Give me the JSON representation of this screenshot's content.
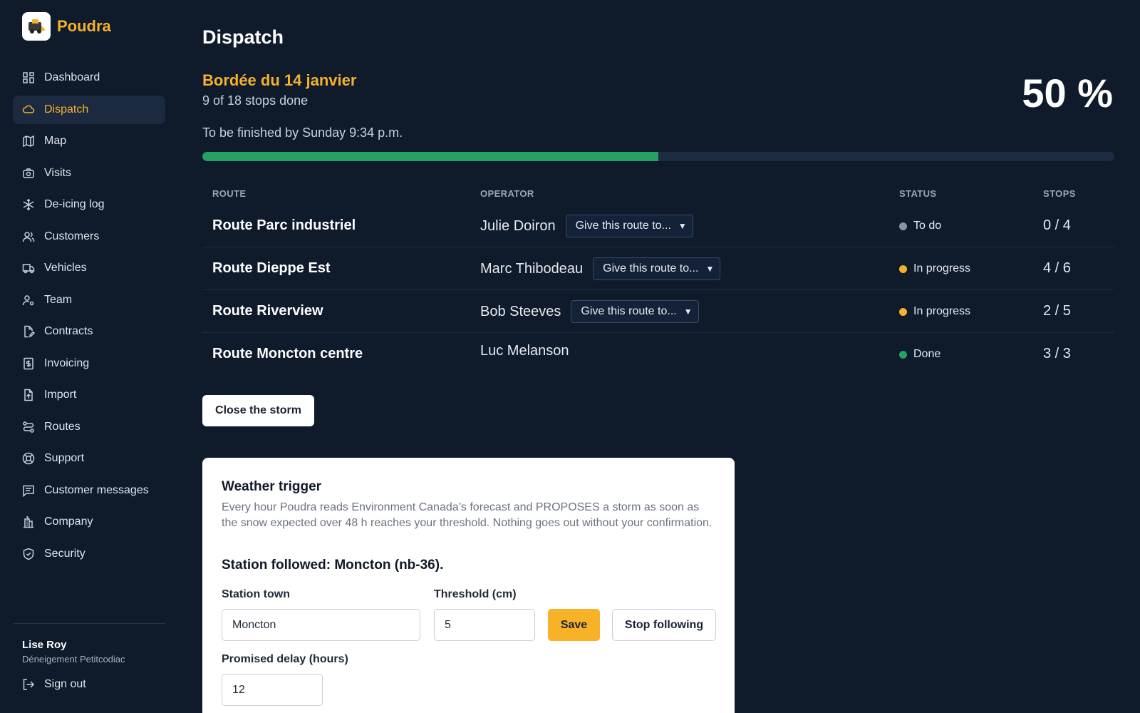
{
  "app": {
    "name": "Poudra"
  },
  "sidebar": {
    "items": [
      {
        "label": "Dashboard",
        "icon": "dashboard-icon"
      },
      {
        "label": "Dispatch",
        "icon": "cloud-icon",
        "active": true
      },
      {
        "label": "Map",
        "icon": "map-icon"
      },
      {
        "label": "Visits",
        "icon": "camera-icon"
      },
      {
        "label": "De-icing log",
        "icon": "snowflake-icon"
      },
      {
        "label": "Customers",
        "icon": "users-icon"
      },
      {
        "label": "Vehicles",
        "icon": "truck-icon"
      },
      {
        "label": "Team",
        "icon": "user-gear-icon"
      },
      {
        "label": "Contracts",
        "icon": "file-edit-icon"
      },
      {
        "label": "Invoicing",
        "icon": "invoice-icon"
      },
      {
        "label": "Import",
        "icon": "file-upload-icon"
      },
      {
        "label": "Routes",
        "icon": "route-icon"
      },
      {
        "label": "Support",
        "icon": "lifebuoy-icon"
      },
      {
        "label": "Customer messages",
        "icon": "message-icon"
      },
      {
        "label": "Company",
        "icon": "building-icon"
      },
      {
        "label": "Security",
        "icon": "shield-icon"
      }
    ],
    "user": {
      "name": "Lise Roy",
      "company": "Déneigement Petitcodiac"
    },
    "signout_label": "Sign out"
  },
  "main": {
    "title": "Dispatch",
    "storm": {
      "name": "Bordée du 14 janvier",
      "progress_text": "9 of 18 stops done",
      "deadline": "To be finished by Sunday 9:34 p.m.",
      "percent_label": "50 %",
      "progress_fraction": 0.5
    },
    "table": {
      "headers": {
        "route": "ROUTE",
        "operator": "OPERATOR",
        "status": "STATUS",
        "stops": "STOPS"
      },
      "give_label": "Give this route to...",
      "rows": [
        {
          "route": "Route Parc industriel",
          "operator": "Julie Doiron",
          "reassign": true,
          "status": "To do",
          "status_color": "#8b94a3",
          "stops": "0 / 4"
        },
        {
          "route": "Route Dieppe Est",
          "operator": "Marc Thibodeau",
          "reassign": true,
          "status": "In progress",
          "status_color": "#f5b12a",
          "stops": "4 / 6"
        },
        {
          "route": "Route Riverview",
          "operator": "Bob Steeves",
          "reassign": true,
          "status": "In progress",
          "status_color": "#f5b12a",
          "stops": "2 / 5"
        },
        {
          "route": "Route Moncton centre",
          "operator": "Luc Melanson",
          "reassign": false,
          "status": "Done",
          "status_color": "#25a162",
          "stops": "3 / 3"
        }
      ]
    },
    "close_label": "Close the storm",
    "weather": {
      "title": "Weather trigger",
      "description": "Every hour Poudra reads Environment Canada’s forecast and PROPOSES a storm as soon as the snow expected over 48 h reaches your threshold. Nothing goes out without your confirmation.",
      "station_followed": "Station followed: Moncton (nb-36).",
      "station_label": "Station town",
      "station_value": "Moncton",
      "threshold_label": "Threshold (cm)",
      "threshold_value": "5",
      "save_label": "Save",
      "stop_label": "Stop following",
      "delay_label": "Promised delay (hours)",
      "delay_value": "12"
    }
  },
  "colors": {
    "accent": "#f5b12a",
    "background": "#0f1a2b",
    "success": "#25a162"
  }
}
